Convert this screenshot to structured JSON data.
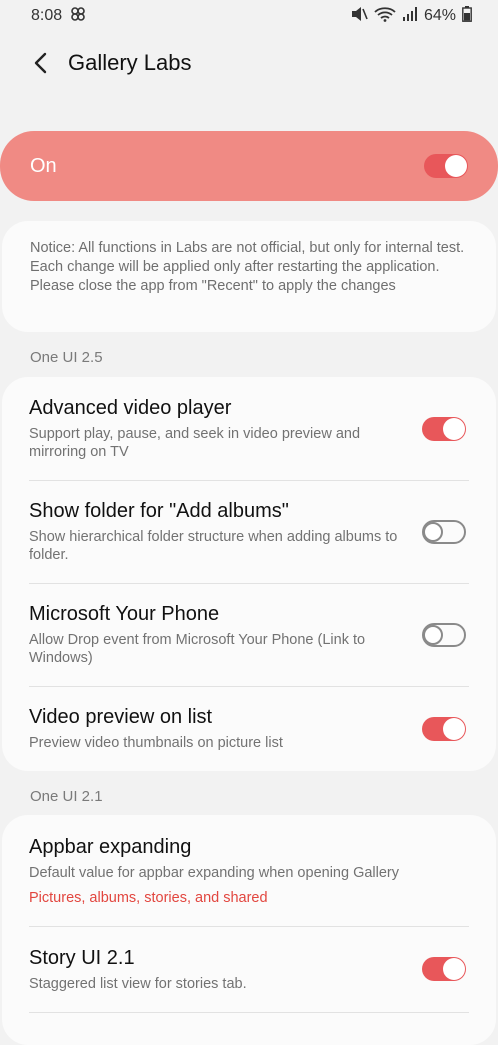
{
  "status_bar": {
    "time": "8:08",
    "battery": "64%"
  },
  "app_bar": {
    "title": "Gallery Labs"
  },
  "master_switch": {
    "label": "On",
    "state": "on"
  },
  "notice": "Notice: All functions in Labs are not official, but only for internal test. Each change will be applied only after restarting the application. Please close the app from \"Recent\" to apply the changes",
  "sections": [
    {
      "header": "One UI 2.5",
      "items": [
        {
          "title": "Advanced video player",
          "desc": "Support play, pause, and seek in video preview and mirroring on TV",
          "state": "on"
        },
        {
          "title": "Show folder for \"Add albums\"",
          "desc": "Show hierarchical folder structure when adding albums to folder.",
          "state": "off"
        },
        {
          "title": "Microsoft Your Phone",
          "desc": "Allow Drop event from Microsoft Your Phone (Link to Windows)",
          "state": "off"
        },
        {
          "title": "Video preview on list",
          "desc": "Preview video thumbnails on picture list",
          "state": "on"
        }
      ]
    },
    {
      "header": "One UI 2.1",
      "items": [
        {
          "title": "Appbar expanding",
          "desc": "Default value for appbar expanding when opening Gallery",
          "sub": "Pictures, albums, stories, and shared"
        },
        {
          "title": "Story UI 2.1",
          "desc": "Staggered list view for stories tab.",
          "state": "on"
        }
      ]
    }
  ],
  "colors": {
    "accent": "#e8575a",
    "master_bg": "#f08a84",
    "sub_text": "#e2463f"
  }
}
